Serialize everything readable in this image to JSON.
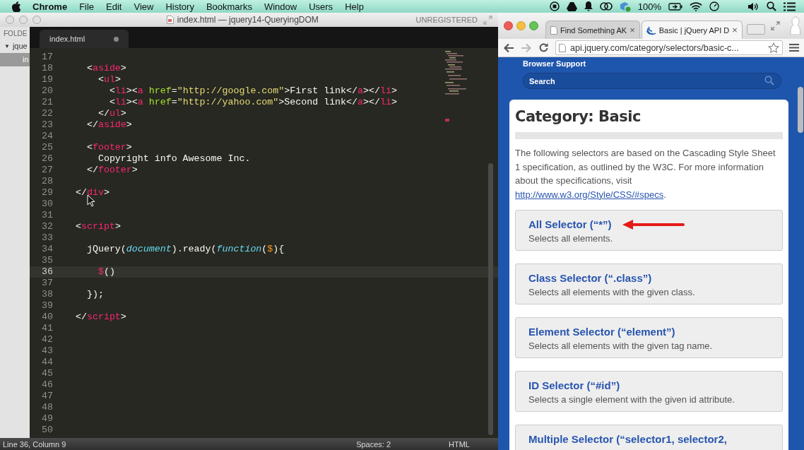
{
  "menu_bar": {
    "app": "Chrome",
    "items": [
      "File",
      "Edit",
      "View",
      "History",
      "Bookmarks",
      "Window",
      "Users",
      "Help"
    ],
    "battery": "100%"
  },
  "editor_window": {
    "title": "index.html — jquery14-QueryingDOM",
    "license": "UNREGISTERED",
    "sidebar": {
      "header": "FOLDE",
      "folder": {
        "arrow": "▼",
        "name": "jque",
        "expanded": true
      },
      "files": [
        {
          "name": "in",
          "selected": true
        }
      ]
    },
    "tabs": [
      {
        "label": "index.html",
        "selected": true,
        "modified": true
      }
    ],
    "lines": [
      {
        "number": "17",
        "current": false
      },
      {
        "number": "18",
        "current": false,
        "tokens": [
          {
            "text": "  <",
            "kind": "plain"
          },
          {
            "text": "aside",
            "kind": "keyword"
          },
          {
            "text": ">",
            "kind": "plain"
          }
        ]
      },
      {
        "number": "19",
        "current": false,
        "tokens": [
          {
            "text": "    <",
            "kind": "plain"
          },
          {
            "text": "ul",
            "kind": "keyword"
          },
          {
            "text": ">",
            "kind": "plain"
          }
        ]
      },
      {
        "number": "20",
        "current": false,
        "tokens": [
          {
            "text": "      <",
            "kind": "plain"
          },
          {
            "text": "li",
            "kind": "keyword"
          },
          {
            "text": "><",
            "kind": "plain"
          },
          {
            "text": "a",
            "kind": "keyword"
          },
          {
            "text": " href",
            "kind": "attr"
          },
          {
            "text": "=",
            "kind": "plain"
          },
          {
            "text": "\"http://google.com\"",
            "kind": "string"
          },
          {
            "text": ">First link</",
            "kind": "plain"
          },
          {
            "text": "a",
            "kind": "keyword"
          },
          {
            "text": "></",
            "kind": "plain"
          },
          {
            "text": "li",
            "kind": "keyword"
          },
          {
            "text": ">",
            "kind": "plain"
          }
        ]
      },
      {
        "number": "21",
        "current": false,
        "tokens": [
          {
            "text": "      <",
            "kind": "plain"
          },
          {
            "text": "li",
            "kind": "keyword"
          },
          {
            "text": "><",
            "kind": "plain"
          },
          {
            "text": "a",
            "kind": "keyword"
          },
          {
            "text": " href",
            "kind": "attr"
          },
          {
            "text": "=",
            "kind": "plain"
          },
          {
            "text": "\"http://yahoo.com\"",
            "kind": "string"
          },
          {
            "text": ">Second link</",
            "kind": "plain"
          },
          {
            "text": "a",
            "kind": "keyword"
          },
          {
            "text": "></",
            "kind": "plain"
          },
          {
            "text": "li",
            "kind": "keyword"
          },
          {
            "text": ">",
            "kind": "plain"
          }
        ]
      },
      {
        "number": "22",
        "current": false,
        "tokens": [
          {
            "text": "    </",
            "kind": "plain"
          },
          {
            "text": "ul",
            "kind": "keyword"
          },
          {
            "text": ">",
            "kind": "plain"
          }
        ]
      },
      {
        "number": "23",
        "current": false,
        "tokens": [
          {
            "text": "  </",
            "kind": "plain"
          },
          {
            "text": "aside",
            "kind": "keyword"
          },
          {
            "text": ">",
            "kind": "plain"
          }
        ]
      },
      {
        "number": "24",
        "current": false
      },
      {
        "number": "25",
        "current": false,
        "tokens": [
          {
            "text": "  <",
            "kind": "plain"
          },
          {
            "text": "footer",
            "kind": "keyword"
          },
          {
            "text": ">",
            "kind": "plain"
          }
        ]
      },
      {
        "number": "26",
        "current": false,
        "tokens": [
          {
            "text": "    Copyright info Awesome Inc.",
            "kind": "plain"
          }
        ]
      },
      {
        "number": "27",
        "current": false,
        "tokens": [
          {
            "text": "  </",
            "kind": "plain"
          },
          {
            "text": "footer",
            "kind": "keyword"
          },
          {
            "text": ">",
            "kind": "plain"
          }
        ]
      },
      {
        "number": "28",
        "current": false
      },
      {
        "number": "29",
        "current": false,
        "tokens": [
          {
            "text": "</",
            "kind": "plain"
          },
          {
            "text": "div",
            "kind": "keyword"
          },
          {
            "text": ">",
            "kind": "plain"
          }
        ]
      },
      {
        "number": "30",
        "current": false
      },
      {
        "number": "31",
        "current": false
      },
      {
        "number": "32",
        "current": false,
        "tokens": [
          {
            "text": "<",
            "kind": "plain"
          },
          {
            "text": "script",
            "kind": "keyword"
          },
          {
            "text": ">",
            "kind": "plain"
          }
        ]
      },
      {
        "number": "33",
        "current": false
      },
      {
        "number": "34",
        "current": false,
        "tokens": [
          {
            "text": "  jQuery(",
            "kind": "plain"
          },
          {
            "text": "document",
            "kind": "storage"
          },
          {
            "text": ").ready(",
            "kind": "plain"
          },
          {
            "text": "function",
            "kind": "storage"
          },
          {
            "text": "(",
            "kind": "plain"
          },
          {
            "text": "$",
            "kind": "param"
          },
          {
            "text": "){",
            "kind": "plain"
          }
        ]
      },
      {
        "number": "35",
        "current": false
      },
      {
        "number": "36",
        "current": true,
        "tokens": [
          {
            "text": "    $",
            "kind": "keyword"
          },
          {
            "text": "()",
            "kind": "plain"
          }
        ]
      },
      {
        "number": "37",
        "current": false
      },
      {
        "number": "38",
        "current": false,
        "tokens": [
          {
            "text": "  });",
            "kind": "plain"
          }
        ]
      },
      {
        "number": "39",
        "current": false
      },
      {
        "number": "40",
        "current": false,
        "tokens": [
          {
            "text": "</",
            "kind": "plain"
          },
          {
            "text": "script",
            "kind": "keyword"
          },
          {
            "text": ">",
            "kind": "plain"
          }
        ]
      },
      {
        "number": "41",
        "current": false
      },
      {
        "number": "42",
        "current": false
      },
      {
        "number": "43",
        "current": false
      },
      {
        "number": "44",
        "current": false
      },
      {
        "number": "45",
        "current": false
      },
      {
        "number": "46",
        "current": false
      },
      {
        "number": "47",
        "current": false
      },
      {
        "number": "48",
        "current": false
      },
      {
        "number": "49",
        "current": false
      },
      {
        "number": "50",
        "current": false
      }
    ],
    "status_bar": {
      "position": "Line 36, Column 9",
      "indent": "Spaces: 2",
      "syntax": "HTML"
    }
  },
  "browser": {
    "tabs": [
      {
        "label": "Find Something AK",
        "selected": false,
        "close": "×"
      },
      {
        "label": "Basic | jQuery API D",
        "selected": true,
        "close": "×"
      }
    ],
    "address": "api.jquery.com/category/selectors/basic-c...",
    "page": {
      "nav_link": "Browser Support",
      "search": {
        "placeholder": "Search"
      },
      "heading": "Category: Basic",
      "intro": "The following selectors are based on the Cascading Style Sheet 1 specification, as outlined by the W3C. For more information about the specifications, visit ",
      "intro_link": "http://www.w3.org/Style/CSS/#specs",
      "intro_end": ".",
      "entries": [
        {
          "title": "All Selector (“*”)",
          "description": "Selects all elements.",
          "highlighted": true
        },
        {
          "title": "Class Selector (“.class”)",
          "description": "Selects all elements with the given class.",
          "highlighted": false
        },
        {
          "title": "Element Selector (“element”)",
          "description": "Selects all elements with the given tag name.",
          "highlighted": false
        },
        {
          "title": "ID Selector (“#id”)",
          "description": "Selects a single element with the given id attribute.",
          "highlighted": false
        },
        {
          "title": "Multiple Selector (“selector1, selector2,",
          "highlighted": false
        }
      ]
    }
  }
}
